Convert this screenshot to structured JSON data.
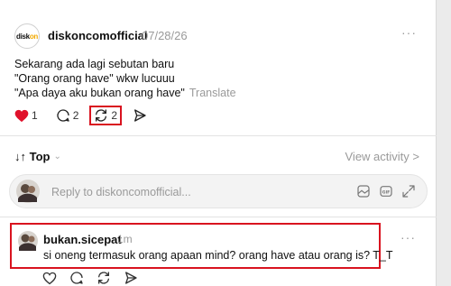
{
  "post": {
    "logo_text_a": "disk",
    "logo_text_b": "on",
    "username": "diskoncomofficial",
    "date": "07/28/26",
    "more": "···",
    "lines": [
      "Sekarang ada lagi sebutan baru",
      "\"Orang orang have\" wkw lucuuu",
      "\"Apa daya aku bukan orang have\""
    ],
    "translate": "Translate",
    "likes": "1",
    "replies": "2",
    "reposts": "2",
    "like_color": "#e0112b"
  },
  "sort": {
    "label": "↓↑ Top",
    "chevron": "⌄",
    "view_activity": "View activity >"
  },
  "reply_box": {
    "placeholder": "Reply to diskoncomofficial..."
  },
  "comment": {
    "username": "bukan.sicepat",
    "time": "1m",
    "text": "si oneng termasuk orang apaan mind? orang have atau orang is? T_T",
    "more": "···"
  },
  "highlight_color": "#d9131f"
}
